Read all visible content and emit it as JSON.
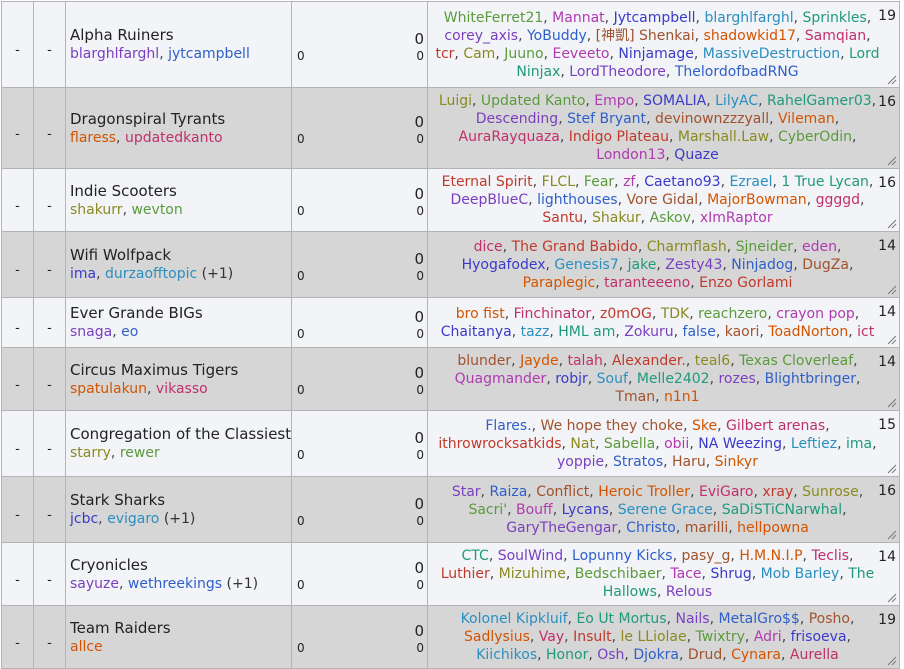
{
  "placeholders": {
    "dash": "-",
    "zero": "0"
  },
  "colors": {
    "row_odd": "#f2f4f7",
    "row_even": "#d6d6d6",
    "palette": [
      "#5a9a3c",
      "#7a3fbf",
      "#c0392b",
      "#2a8fbf",
      "#d35400",
      "#b03ab0",
      "#2f5fc9",
      "#8a8a20",
      "#1f9a7a",
      "#c0306a",
      "#3a3ac9",
      "#a0522d"
    ]
  },
  "teams": [
    {
      "name": "Alpha Ruiners",
      "captains": [
        "blarghlfarghl",
        "jytcampbell"
      ],
      "extra": "",
      "count": "19",
      "players": [
        "WhiteFerret21",
        "Mannat",
        "Jytcampbell",
        "blarghlfarghl",
        "Sprinkles",
        "corey_axis",
        "YoBuddy",
        "[神凱] Shenkai",
        "shadowkid17",
        "Samqian",
        "tcr",
        "Cam",
        "Juuno",
        "Eeveeto",
        "Ninjamage",
        "MassiveDestruction",
        "Lord Ninjax",
        "LordTheodore",
        "ThelordofbadRNG"
      ]
    },
    {
      "name": "Dragonspiral Tyrants",
      "captains": [
        "flaress",
        "updatedkanto"
      ],
      "extra": "",
      "count": "16",
      "players": [
        "Luigi",
        "Updated Kanto",
        "Empo",
        "SOMALIA",
        "LilyAC",
        "RahelGamer03",
        "Descending",
        "Stef Bryant",
        "devinownzzzyall",
        "Vileman",
        "AuraRayquaza",
        "Indigo Plateau",
        "Marshall.Law",
        "CyberOdin",
        "London13",
        "Quaze"
      ]
    },
    {
      "name": "Indie Scooters",
      "captains": [
        "shakurr",
        "wevton"
      ],
      "extra": "",
      "count": "16",
      "players": [
        "Eternal Spirit",
        "FLCL",
        "Fear",
        "zf",
        "Caetano93",
        "Ezrael",
        "1 True Lycan",
        "DeepBlueC",
        "lighthouses",
        "Vore Gidal",
        "MajorBowman",
        "ggggd",
        "Santu",
        "Shakur",
        "Askov",
        "xImRaptor"
      ]
    },
    {
      "name": "Wifi Wolfpack",
      "captains": [
        "ima",
        "durzaofftopic"
      ],
      "extra": "(+1)",
      "count": "14",
      "players": [
        "dice",
        "The Grand Babido",
        "Charmflash",
        "Sjneider",
        "eden",
        "Hyogafodex",
        "Genesis7",
        "jake",
        "Zesty43",
        "Ninjadog",
        "DugZa",
        "Paraplegic",
        "taranteeeno",
        "Enzo Gorlami"
      ]
    },
    {
      "name": "Ever Grande BIGs",
      "captains": [
        "snaga",
        "eo"
      ],
      "extra": "",
      "count": "14",
      "players": [
        "bro fist",
        "Finchinator",
        "z0mOG",
        "TDK",
        "reachzero",
        "crayon pop",
        "Chaitanya",
        "tazz",
        "HML am",
        "Zokuru",
        "false",
        "kaori",
        "ToadNorton",
        "ict"
      ]
    },
    {
      "name": "Circus Maximus Tigers",
      "captains": [
        "spatulakun",
        "vikasso"
      ],
      "extra": "",
      "count": "14",
      "players": [
        "blunder",
        "Jayde",
        "talah",
        "Alexander.",
        "teal6",
        "Texas Cloverleaf",
        "Quagmander",
        "robjr",
        "Souf",
        "Melle2402",
        "rozes",
        "Blightbringer",
        "Tman",
        "n1n1"
      ]
    },
    {
      "name": "Congregation of the Classiest",
      "captains": [
        "starry",
        "rewer"
      ],
      "extra": "",
      "count": "15",
      "players": [
        "Flares.",
        "We hope they choke",
        "Ske",
        "Gilbert arenas",
        "ithrowrocksatkids",
        "Nat",
        "Sabella",
        "obii",
        "NA Weezing",
        "Leftiez",
        "ima",
        "yoppie",
        "Stratos",
        "Haru",
        "Sinkyr"
      ]
    },
    {
      "name": "Stark Sharks",
      "captains": [
        "jcbc",
        "evigaro"
      ],
      "extra": "(+1)",
      "count": "16",
      "players": [
        "Star",
        "Raiza",
        "Conflict",
        "Heroic Troller",
        "EviGaro",
        "xray",
        "Sunrose",
        "Sacri'",
        "Bouff",
        "Lycans",
        "Serene Grace",
        "SaDiSTiCNarwhal",
        "GaryTheGengar",
        "Christo",
        "marilli",
        "hellpowna"
      ]
    },
    {
      "name": "Cryonicles",
      "captains": [
        "sayuze",
        "wethreekings"
      ],
      "extra": "(+1)",
      "count": "14",
      "players": [
        "CTC",
        "SoulWind",
        "Lopunny Kicks",
        "pasy_g",
        "H.M.N.I.P",
        "Teclis",
        "Luthier",
        "Mizuhime",
        "Bedschibaer",
        "Tace",
        "Shrug",
        "Mob Barley",
        "The Hallows",
        "Relous"
      ]
    },
    {
      "name": "Team Raiders",
      "captains": [
        "allce"
      ],
      "extra": "",
      "count": "19",
      "players": [
        "Kolonel Kipkluif",
        "Eo Ut Mortus",
        "Nails",
        "MetalGro$$",
        "Posho",
        "Sadlysius",
        "Vay",
        "Insult",
        "le LLiolae",
        "Twixtry",
        "Adri",
        "frisoeva",
        "Kiichikos",
        "Honor",
        "Osh",
        "Djokra",
        "Drud",
        "Cynara",
        "Aurella"
      ]
    }
  ]
}
